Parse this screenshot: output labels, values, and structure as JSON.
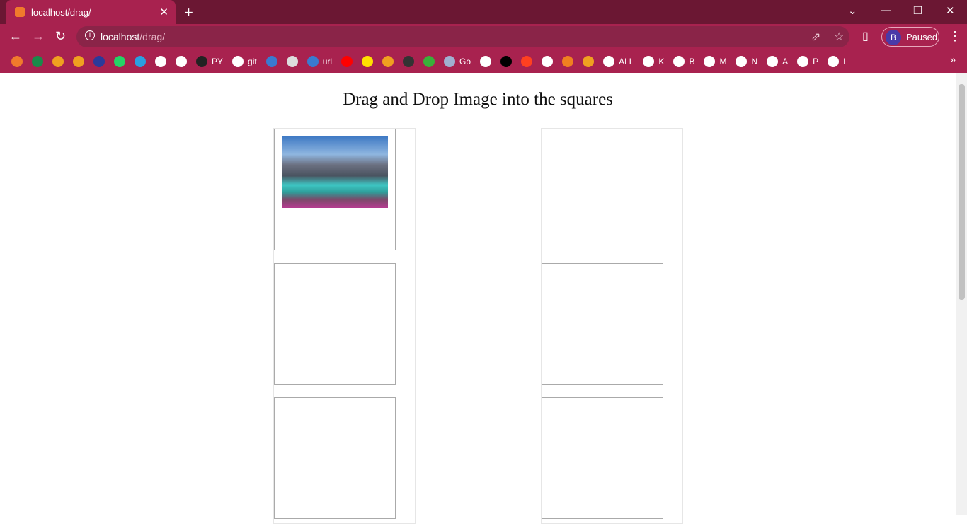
{
  "browser": {
    "tab_title": "localhost/drag/",
    "url_host": "localhost",
    "url_path": "/drag/",
    "profile_initial": "B",
    "profile_status": "Paused",
    "bookmarks": [
      {
        "label": "",
        "color": "#f07a2c"
      },
      {
        "label": "",
        "color": "#1a8a4a"
      },
      {
        "label": "",
        "color": "#f0a020"
      },
      {
        "label": "",
        "color": "#f0a020"
      },
      {
        "label": "",
        "color": "#2a3a9a"
      },
      {
        "label": "",
        "color": "#25d366"
      },
      {
        "label": "",
        "color": "#2aa0e0"
      },
      {
        "label": "",
        "color": "#ffffff"
      },
      {
        "label": "",
        "color": "#ffffff"
      },
      {
        "label": "PY",
        "color": "#222222"
      },
      {
        "label": "git",
        "color": "#ffffff"
      },
      {
        "label": "",
        "color": "#3a7ad0"
      },
      {
        "label": "",
        "color": "#dddddd"
      },
      {
        "label": "url",
        "color": "#3a7ad0"
      },
      {
        "label": "",
        "color": "#ff0000"
      },
      {
        "label": "",
        "color": "#ffe000"
      },
      {
        "label": "",
        "color": "#f0a020"
      },
      {
        "label": "",
        "color": "#333333"
      },
      {
        "label": "",
        "color": "#3ab03a"
      },
      {
        "label": "Go",
        "color": "#a0b0d0"
      },
      {
        "label": "",
        "color": "#ffffff"
      },
      {
        "label": "",
        "color": "#000000"
      },
      {
        "label": "",
        "color": "#ff4020"
      },
      {
        "label": "",
        "color": "#ffffff"
      },
      {
        "label": "",
        "color": "#f08020"
      },
      {
        "label": "",
        "color": "#f0a020"
      },
      {
        "label": "ALL",
        "color": "#ffffff"
      },
      {
        "label": "K",
        "color": "#ffffff"
      },
      {
        "label": "B",
        "color": "#ffffff"
      },
      {
        "label": "M",
        "color": "#ffffff"
      },
      {
        "label": "N",
        "color": "#ffffff"
      },
      {
        "label": "A",
        "color": "#ffffff"
      },
      {
        "label": "P",
        "color": "#ffffff"
      },
      {
        "label": "I",
        "color": "#ffffff"
      }
    ]
  },
  "page": {
    "title": "Drag and Drop Image into the squares"
  }
}
